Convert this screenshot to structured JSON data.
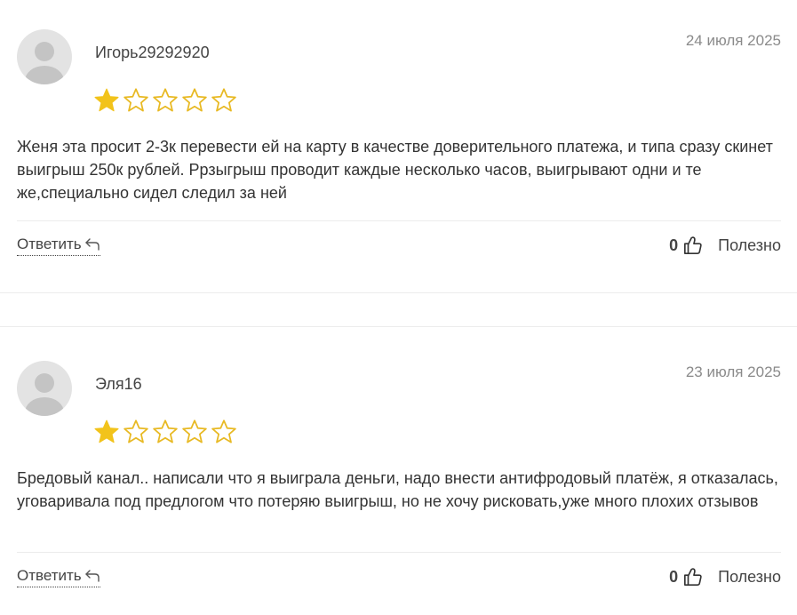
{
  "reviews": [
    {
      "username": "Игорь29292920",
      "date": "24 июля 2025",
      "rating": 1,
      "max_rating": 5,
      "text": "Женя эта просит 2-3к перевести ей на карту в качестве доверительного платежа, и типа сразу скинет выигрыш 250к рублей. Ррзыгрыш проводит каждые несколько часов, выигрывают одни и те же,специально сидел следил за ней",
      "reply_label": "Ответить",
      "useful_count": "0",
      "useful_label": "Полезно"
    },
    {
      "username": "Эля16",
      "date": "23 июля 2025",
      "rating": 1,
      "max_rating": 5,
      "text": "Бредовый канал.. написали что я выиграла деньги, надо внести антифродовый платёж, я отказалась, уговаривала под предлогом что потеряю выигрыш, но не хочу рисковать,уже много плохих отзывов",
      "reply_label": "Ответить",
      "useful_count": "0",
      "useful_label": "Полезно"
    }
  ],
  "colors": {
    "star_filled": "#f2c31b",
    "star_outline": "#e8b923",
    "avatar_bg": "#e3e3e3",
    "avatar_figure": "#c4c4c4",
    "divider": "#ececec"
  }
}
